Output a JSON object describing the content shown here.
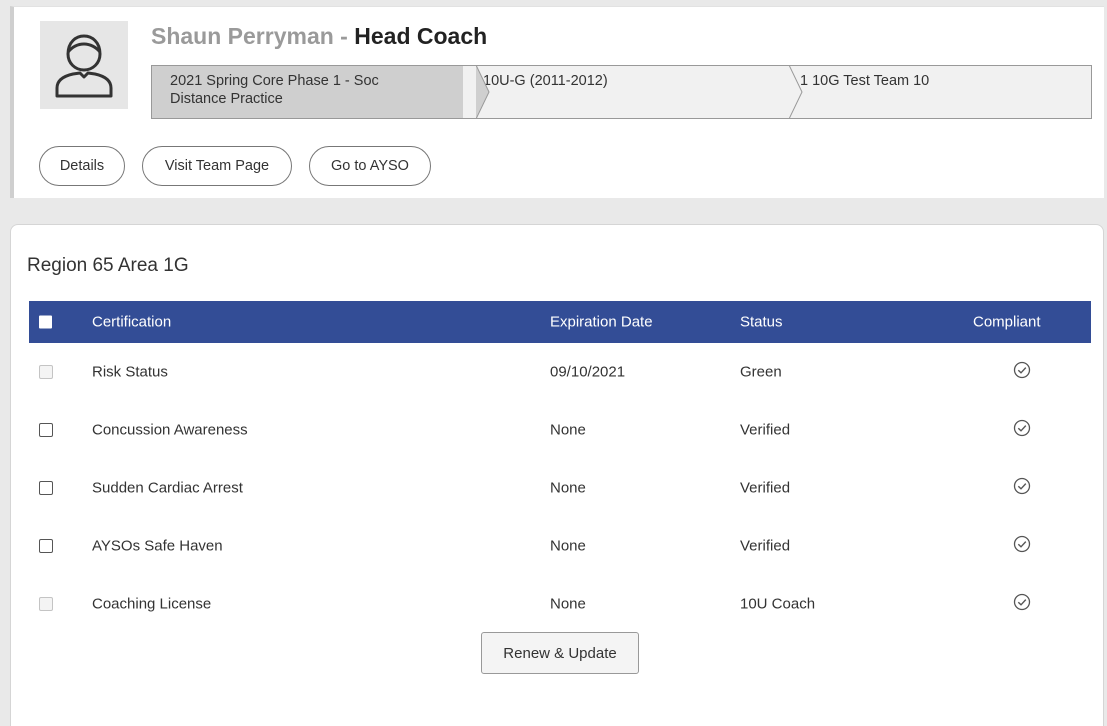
{
  "header": {
    "coach_name": "Shaun Perryman",
    "separator": " - ",
    "role": "Head Coach",
    "avatar_icon": "user-outline-icon",
    "breadcrumb": [
      {
        "line1": "2021 Spring Core Phase 1 - Soc",
        "line2": "Distance Practice"
      },
      {
        "line1": "10U-G (2011-2012)",
        "line2": ""
      },
      {
        "line1": "1 10G Test Team 10",
        "line2": ""
      }
    ],
    "buttons": {
      "details": "Details",
      "visit_team": "Visit Team Page",
      "go_ayso": "Go to AYSO"
    }
  },
  "main": {
    "region_title": "Region 65 Area 1G",
    "table": {
      "header_color": "#334d96",
      "columns": {
        "certification": "Certification",
        "expiration": "Expiration Date",
        "status": "Status",
        "compliant": "Compliant"
      },
      "rows": [
        {
          "certification": "Risk Status",
          "expiration": "09/10/2021",
          "status": "Green",
          "checkbox_enabled": false,
          "compliant_icon": "check-circle-icon"
        },
        {
          "certification": "Concussion Awareness",
          "expiration": "None",
          "status": "Verified",
          "checkbox_enabled": true,
          "compliant_icon": "check-circle-icon"
        },
        {
          "certification": "Sudden Cardiac Arrest",
          "expiration": "None",
          "status": "Verified",
          "checkbox_enabled": true,
          "compliant_icon": "check-circle-icon"
        },
        {
          "certification": "AYSOs Safe Haven",
          "expiration": "None",
          "status": "Verified",
          "checkbox_enabled": true,
          "compliant_icon": "check-circle-icon"
        },
        {
          "certification": "Coaching License",
          "expiration": "None",
          "status": "10U Coach",
          "checkbox_enabled": false,
          "compliant_icon": "check-circle-icon"
        }
      ]
    },
    "renew_button": "Renew & Update"
  }
}
